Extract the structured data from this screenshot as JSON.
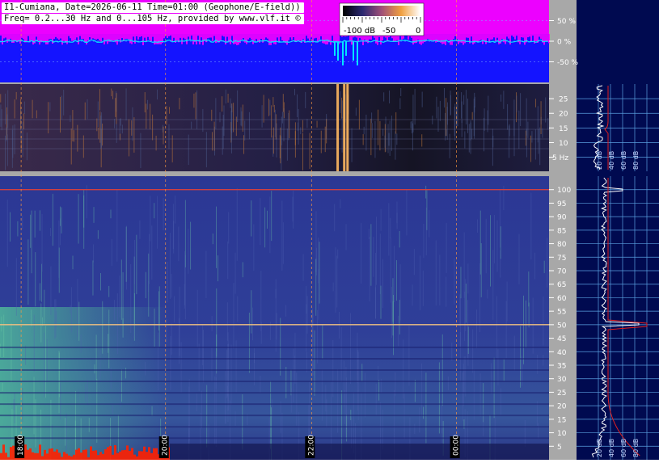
{
  "header": {
    "line1": "I1-Cumiana, Date=2026-06-11 Time=01:00 (Geophone/E-field))",
    "line2": "Freq= 0.2...30 Hz and 0...105 Hz, provided by www.vlf.it ©"
  },
  "colors": {
    "waveform_bg": "#1414ff",
    "waveform_fill": "#ff00ff",
    "waveform_trace": "#00e5ff",
    "axis_bg": "#a8a8a8",
    "right_panel_bg": "#000a50",
    "grid": "#5aa0e0",
    "spectrum_line": "#ffffff",
    "spectrum_avg": "#e02020",
    "spectrogram_low": "#2a3590",
    "spectrogram_mid": "#4ad0a0",
    "spectrogram_hot": "#ff2000",
    "marker_line": "#ff9a40"
  },
  "chart_data": [
    {
      "type": "line",
      "panel": "waveform",
      "yticks": [
        "50 %",
        "0 %",
        "-50 %"
      ],
      "y_values": [
        50,
        0,
        -50
      ],
      "ylim": [
        -100,
        100
      ],
      "colorbar": {
        "labels": [
          "-100 dB",
          "-50",
          "0"
        ],
        "range_db": [
          -100,
          0
        ]
      }
    },
    {
      "type": "heatmap",
      "panel": "spectrogram-low",
      "ylim": [
        0.2,
        30
      ],
      "yticks": [
        "25",
        "20",
        "15",
        "10",
        "5 Hz"
      ],
      "y_values": [
        25,
        20,
        15,
        10,
        5
      ],
      "strong_vertical_events_fraction": [
        0.615,
        0.627,
        0.633
      ]
    },
    {
      "type": "heatmap",
      "panel": "spectrogram-high",
      "ylim": [
        0,
        105
      ],
      "yticks": [
        "100",
        "95",
        "90",
        "85",
        "80",
        "75",
        "70",
        "65",
        "60",
        "55",
        "50",
        "45",
        "40",
        "35",
        "30",
        "25",
        "20",
        "15",
        "10",
        "5"
      ],
      "y_values": [
        100,
        95,
        90,
        85,
        80,
        75,
        70,
        65,
        60,
        55,
        50,
        45,
        40,
        35,
        30,
        25,
        20,
        15,
        10,
        5
      ],
      "persistent_lines_hz": [
        100,
        50
      ],
      "time_labels": [
        "18:00",
        "20:00",
        "22:00",
        "00:00"
      ],
      "time_label_fraction": [
        0.065,
        0.328,
        0.594,
        0.858
      ]
    },
    {
      "type": "line",
      "panel": "spectrum-low",
      "xticks": [
        "20 dB",
        "40 dB",
        "60 dB",
        "80 dB"
      ],
      "series": [
        {
          "name": "",
          "values": []
        }
      ]
    },
    {
      "type": "line",
      "panel": "spectrum-high",
      "xticks": [
        "20 dB",
        "40 dB",
        "60 dB",
        "80 dB"
      ],
      "peaks_hz": [
        100,
        50
      ]
    }
  ]
}
